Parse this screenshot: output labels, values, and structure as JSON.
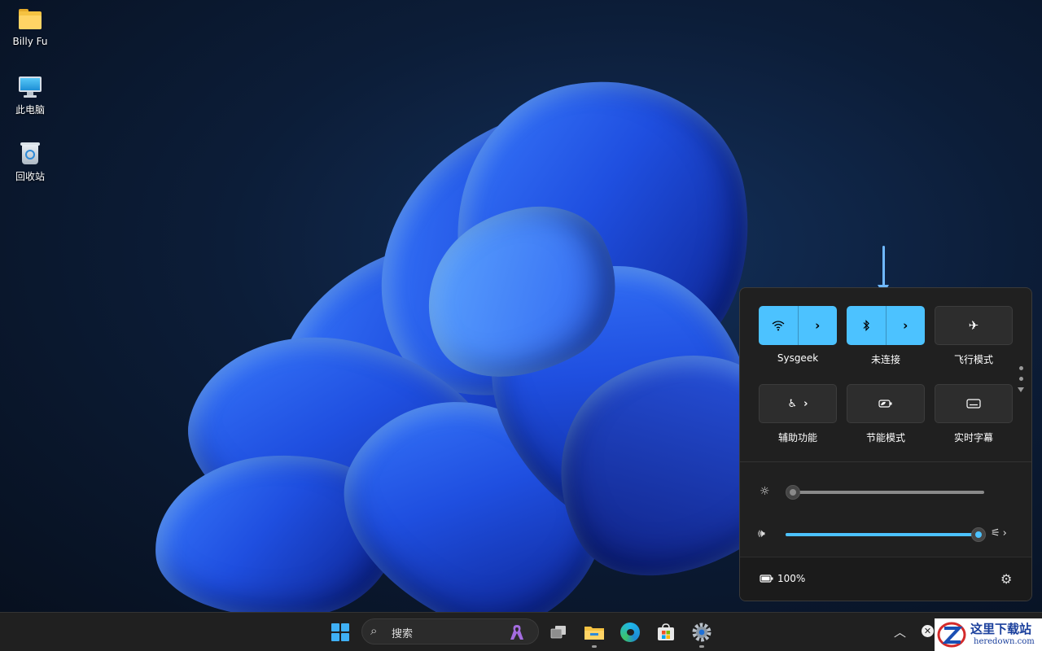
{
  "desktop": {
    "icons": [
      {
        "label": "Billy Fu",
        "icon": "folder-icon"
      },
      {
        "label": "此电脑",
        "icon": "computer-icon"
      },
      {
        "label": "回收站",
        "icon": "recycle-bin-icon"
      }
    ]
  },
  "quick_settings": {
    "tiles": [
      {
        "label": "Sysgeek",
        "icon": "wifi-icon",
        "state": "on",
        "has_arrow": true
      },
      {
        "label": "未连接",
        "icon": "bluetooth-icon",
        "state": "on",
        "has_arrow": true
      },
      {
        "label": "飞行模式",
        "icon": "airplane-icon",
        "state": "off",
        "has_arrow": false
      },
      {
        "label": "辅助功能",
        "icon": "accessibility-icon",
        "state": "off",
        "has_arrow": true
      },
      {
        "label": "节能模式",
        "icon": "energy-saver-icon",
        "state": "off",
        "has_arrow": false
      },
      {
        "label": "实时字幕",
        "icon": "live-captions-icon",
        "state": "off",
        "has_arrow": false
      }
    ],
    "brightness": {
      "value": 0,
      "icon": "brightness-icon"
    },
    "volume": {
      "value": 100,
      "icon": "speaker-icon"
    },
    "battery": {
      "text": "100%",
      "icon": "battery-charging-icon"
    },
    "settings_icon": "gear-icon"
  },
  "taskbar": {
    "search_placeholder": "搜索",
    "accent": "#4cc2ff"
  },
  "watermark": {
    "title": "这里下载站",
    "url": "heredown.com"
  }
}
